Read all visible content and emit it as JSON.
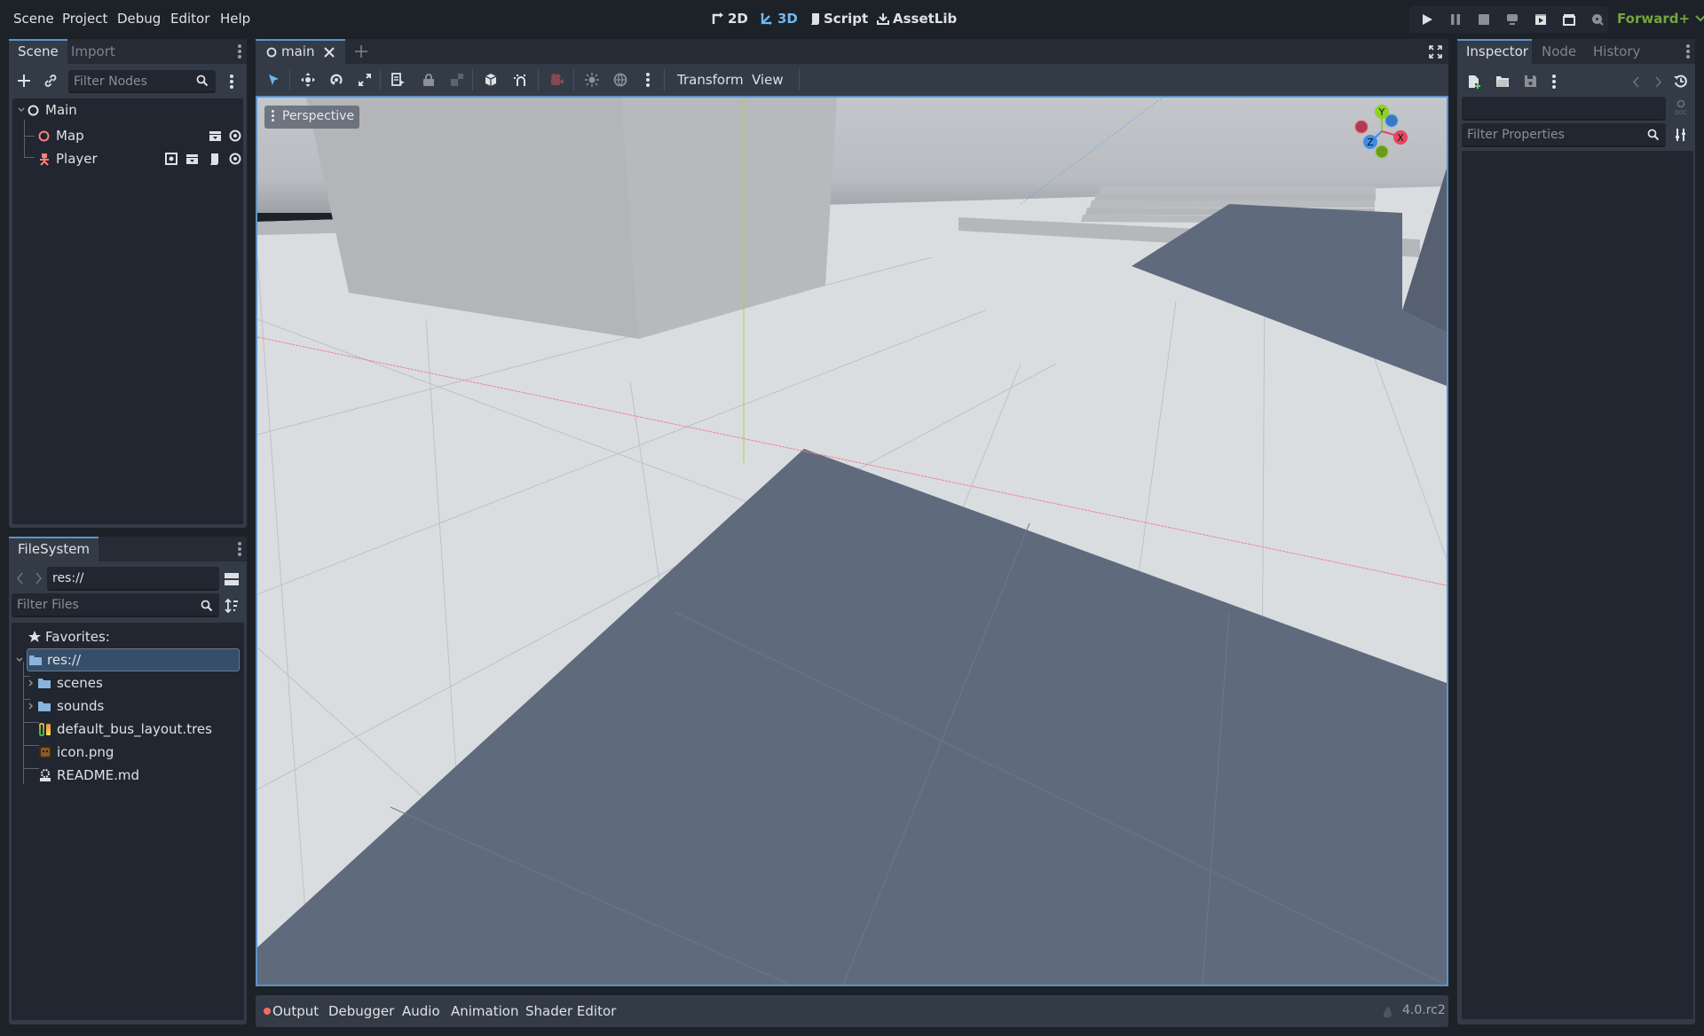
{
  "menu": [
    "Scene",
    "Project",
    "Debug",
    "Editor",
    "Help"
  ],
  "workspaces": [
    {
      "label": "2D",
      "icon": "2d-icon",
      "active": false
    },
    {
      "label": "3D",
      "icon": "3d-icon",
      "active": true
    },
    {
      "label": "Script",
      "icon": "script-icon",
      "active": false
    },
    {
      "label": "AssetLib",
      "icon": "download-icon",
      "active": false
    }
  ],
  "play_controls": [
    "play-icon",
    "pause-icon",
    "stop-icon",
    "remote-debug-icon",
    "play-scene-icon",
    "play-custom-scene-icon",
    "movie-maker-icon"
  ],
  "renderer": "Forward+",
  "scene_dock": {
    "tabs": [
      "Scene",
      "Import"
    ],
    "active_tab": "Scene",
    "filter_placeholder": "Filter Nodes",
    "tree": [
      {
        "name": "Main",
        "icon": "node3d-icon",
        "expanded": true,
        "depth": 0
      },
      {
        "name": "Map",
        "icon": "node3d-icon",
        "depth": 1,
        "badges": [
          "instance-icon",
          "visibility-icon"
        ]
      },
      {
        "name": "Player",
        "icon": "character-icon",
        "depth": 1,
        "badges": [
          "group-icon",
          "instance-icon",
          "script-icon",
          "visibility-icon"
        ]
      }
    ]
  },
  "filesystem": {
    "title": "FileSystem",
    "path": "res://",
    "filter_placeholder": "Filter Files",
    "favorites_label": "Favorites:",
    "tree": [
      {
        "name": "res://",
        "icon": "folder-icon",
        "selected": true,
        "depth": 0
      },
      {
        "name": "scenes",
        "icon": "folder-icon",
        "depth": 1,
        "collapsible": true
      },
      {
        "name": "sounds",
        "icon": "folder-icon",
        "depth": 1,
        "collapsible": true
      },
      {
        "name": "default_bus_layout.tres",
        "icon": "audio-bus-icon",
        "depth": 1
      },
      {
        "name": "icon.png",
        "icon": "image-icon",
        "depth": 1
      },
      {
        "name": "README.md",
        "icon": "text-file-icon",
        "depth": 1
      }
    ]
  },
  "editor_tabs": [
    {
      "label": "main",
      "closable": true
    }
  ],
  "viewport_toolbar": {
    "menus": [
      "Transform",
      "View"
    ],
    "view_mode": "Perspective"
  },
  "gizmo_axes": [
    "Y",
    "X",
    "Z"
  ],
  "bottom_panel": {
    "tabs": [
      "Output",
      "Debugger",
      "Audio",
      "Animation",
      "Shader Editor"
    ],
    "version": "4.0.rc2"
  },
  "inspector_dock": {
    "tabs": [
      "Inspector",
      "Node",
      "History"
    ],
    "active_tab": "Inspector",
    "filter_placeholder": "Filter Properties"
  },
  "colors": {
    "accent": "#5c93c9",
    "active_workspace": "#71b7f0",
    "renderer": "#76a53e",
    "axis_x": "#e8465d",
    "axis_y": "#8fd024",
    "axis_z": "#3d8ee8"
  }
}
